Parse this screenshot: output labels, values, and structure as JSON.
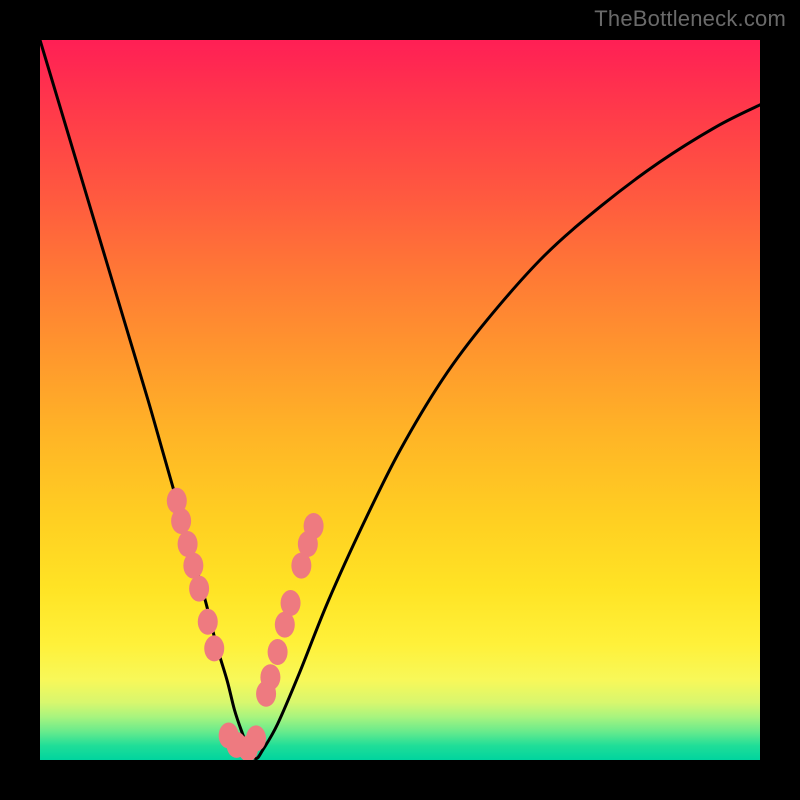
{
  "watermark": "TheBottleneck.com",
  "chart_data": {
    "type": "line",
    "title": "",
    "xlabel": "",
    "ylabel": "",
    "xlim": [
      0,
      100
    ],
    "ylim": [
      0,
      100
    ],
    "grid": false,
    "legend": false,
    "series": [
      {
        "name": "bottleneck-curve",
        "x": [
          0,
          3,
          6,
          9,
          12,
          15,
          17,
          19,
          21,
          23,
          24.5,
          26,
          27,
          28,
          29,
          30,
          31,
          33,
          36,
          40,
          45,
          50,
          56,
          62,
          70,
          78,
          86,
          94,
          100
        ],
        "y": [
          100,
          90,
          80,
          70,
          60,
          50,
          43,
          36,
          29,
          22,
          16,
          11,
          7,
          4,
          1.5,
          0.2,
          1.5,
          5,
          12,
          22,
          33,
          43,
          53,
          61,
          70,
          77,
          83,
          88,
          91
        ]
      }
    ],
    "markers_left": {
      "name": "left-cluster",
      "color": "#ee7a80",
      "points": [
        {
          "x": 19.0,
          "y": 36.0
        },
        {
          "x": 19.6,
          "y": 33.2
        },
        {
          "x": 20.5,
          "y": 30.0
        },
        {
          "x": 21.3,
          "y": 27.0
        },
        {
          "x": 22.1,
          "y": 23.8
        },
        {
          "x": 23.3,
          "y": 19.2
        },
        {
          "x": 24.2,
          "y": 15.5
        }
      ]
    },
    "markers_right": {
      "name": "right-cluster",
      "color": "#ee7a80",
      "points": [
        {
          "x": 31.4,
          "y": 9.2
        },
        {
          "x": 32.0,
          "y": 11.5
        },
        {
          "x": 33.0,
          "y": 15.0
        },
        {
          "x": 34.0,
          "y": 18.8
        },
        {
          "x": 34.8,
          "y": 21.8
        },
        {
          "x": 36.3,
          "y": 27.0
        },
        {
          "x": 37.2,
          "y": 30.0
        },
        {
          "x": 38.0,
          "y": 32.5
        }
      ]
    },
    "markers_bottom": {
      "name": "bottom-cluster",
      "color": "#ee7a80",
      "points": [
        {
          "x": 26.2,
          "y": 3.4
        },
        {
          "x": 27.3,
          "y": 2.1
        },
        {
          "x": 28.9,
          "y": 1.6
        },
        {
          "x": 30.0,
          "y": 3.0
        }
      ]
    },
    "background_gradient": [
      {
        "stop": 0.0,
        "color": "#ff1f55"
      },
      {
        "stop": 0.1,
        "color": "#ff3a4a"
      },
      {
        "stop": 0.22,
        "color": "#ff5a3f"
      },
      {
        "stop": 0.33,
        "color": "#ff7a35"
      },
      {
        "stop": 0.44,
        "color": "#ff982d"
      },
      {
        "stop": 0.55,
        "color": "#ffb526"
      },
      {
        "stop": 0.66,
        "color": "#ffce22"
      },
      {
        "stop": 0.76,
        "color": "#ffe324"
      },
      {
        "stop": 0.84,
        "color": "#fff13a"
      },
      {
        "stop": 0.89,
        "color": "#f7f85a"
      },
      {
        "stop": 0.92,
        "color": "#d8f76e"
      },
      {
        "stop": 0.94,
        "color": "#a8f47e"
      },
      {
        "stop": 0.96,
        "color": "#6aeb8c"
      },
      {
        "stop": 0.98,
        "color": "#20de98"
      },
      {
        "stop": 1.0,
        "color": "#00d49e"
      }
    ]
  }
}
